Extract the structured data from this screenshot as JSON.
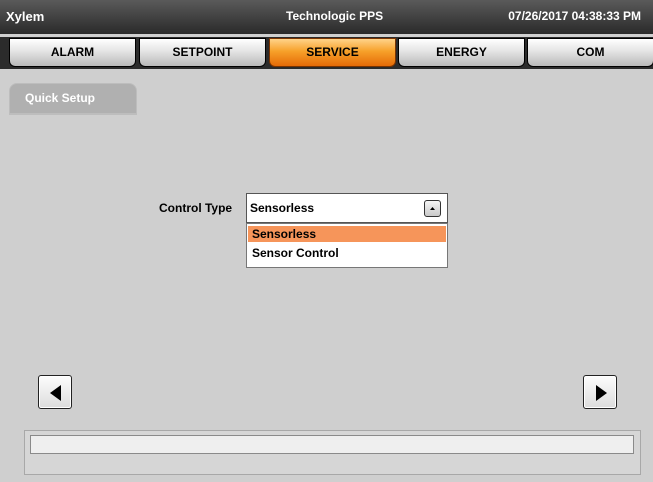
{
  "titlebar": {
    "app_name": "Xylem",
    "product": "Technologic PPS",
    "datetime": "07/26/2017 04:38:33 PM"
  },
  "tabs": [
    {
      "label": "ALARM",
      "active": false
    },
    {
      "label": "SETPOINT",
      "active": false
    },
    {
      "label": "SERVICE",
      "active": true
    },
    {
      "label": "ENERGY",
      "active": false
    },
    {
      "label": "COM",
      "active": false
    }
  ],
  "side_tab": {
    "label": "Quick Setup"
  },
  "control_type": {
    "label": "Control Type",
    "selected": "Sensorless",
    "options": [
      "Sensorless",
      "Sensor Control"
    ],
    "highlighted_option": "Sensorless"
  },
  "navigation": {
    "prev_icon": "left-triangle-icon",
    "next_icon": "right-triangle-icon"
  },
  "status_bar": {
    "message": ""
  },
  "colors": {
    "active_tab": "#f7a12a",
    "highlight": "#f6955a",
    "background": "#cfcfcf"
  }
}
